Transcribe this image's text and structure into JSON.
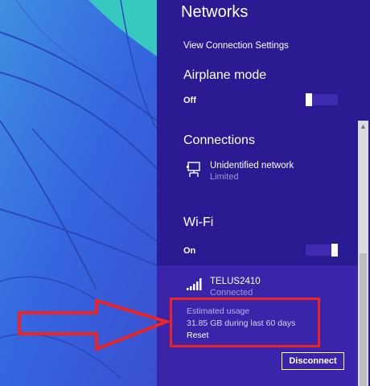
{
  "panel": {
    "title": "Networks",
    "view_settings": "View Connection Settings"
  },
  "airplane": {
    "heading": "Airplane mode",
    "state": "Off"
  },
  "connections": {
    "heading": "Connections",
    "network_name": "Unidentified network",
    "network_status": "Limited"
  },
  "wifi": {
    "heading": "Wi-Fi",
    "state": "On",
    "network_name": "TELUS2410",
    "network_status": "Connected",
    "usage_label": "Estimated usage",
    "usage_value": "31.85 GB during last 60 days",
    "reset_label": "Reset",
    "disconnect_label": "Disconnect"
  },
  "colors": {
    "panel_bg": "#2b1b92",
    "selected_bg": "#3a25aa",
    "highlight": "#ee2424"
  },
  "icons": [
    "wired-network-icon",
    "wifi-signal-icon",
    "scroll-up-arrow-icon"
  ]
}
